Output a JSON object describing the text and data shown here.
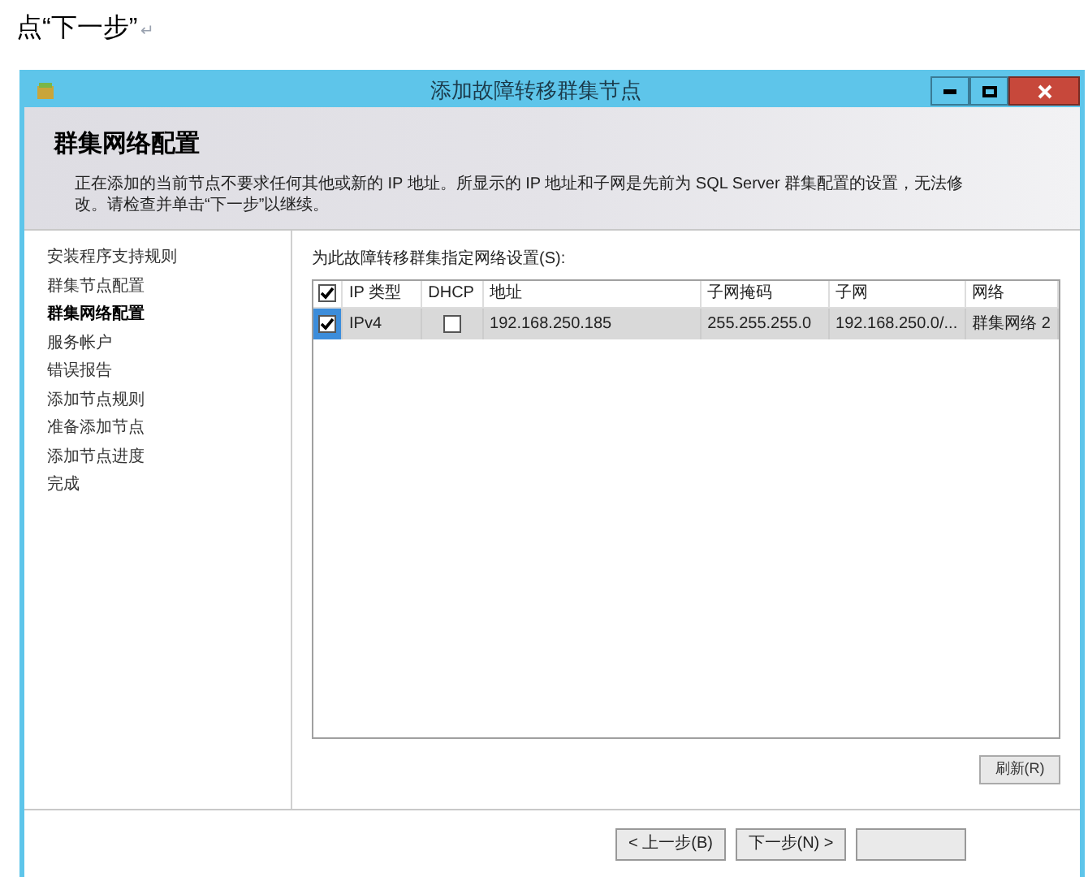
{
  "document_text": "点“下一步”",
  "paragraph_mark": "↵",
  "window": {
    "title": "添加故障转移群集节点"
  },
  "header": {
    "title": "群集网络配置",
    "description": "正在添加的当前节点不要求任何其他或新的 IP 地址。所显示的 IP 地址和子网是先前为 SQL Server 群集配置的设置，无法修改。请检查并单击“下一步”以继续。"
  },
  "sidebar": {
    "items": [
      {
        "label": "安装程序支持规则",
        "selected": false
      },
      {
        "label": "群集节点配置",
        "selected": false
      },
      {
        "label": "群集网络配置",
        "selected": true
      },
      {
        "label": "服务帐户",
        "selected": false
      },
      {
        "label": "错误报告",
        "selected": false
      },
      {
        "label": "添加节点规则",
        "selected": false
      },
      {
        "label": "准备添加节点",
        "selected": false
      },
      {
        "label": "添加节点进度",
        "selected": false
      },
      {
        "label": "完成",
        "selected": false
      }
    ]
  },
  "network_label": "为此故障转移群集指定网络设置(S):",
  "table": {
    "header_checked": true,
    "columns": [
      "IP 类型",
      "DHCP",
      "地址",
      "子网掩码",
      "子网",
      "网络"
    ],
    "rows": [
      {
        "checked": true,
        "selected": true,
        "ip_type": "IPv4",
        "dhcp": false,
        "address": "192.168.250.185",
        "mask": "255.255.255.0",
        "subnet": "192.168.250.0/...",
        "network": "群集网络 2"
      }
    ]
  },
  "refresh_button": "刷新(R)",
  "buttons": [
    {
      "label": "< 上一步(B)"
    },
    {
      "label": "下一步(N) >"
    }
  ]
}
